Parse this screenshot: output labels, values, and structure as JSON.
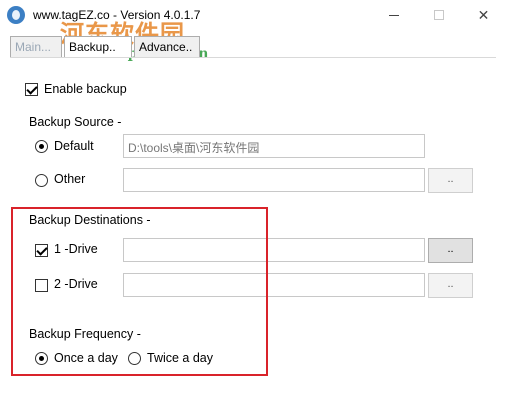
{
  "window": {
    "title": "www.tagEZ.co - Version 4.0.1.7",
    "controls": {
      "minimize": "minimize",
      "maximize": "maximize",
      "close": "✕"
    }
  },
  "watermark": {
    "text": "河东软件园",
    "url": "www.pc0359.cn"
  },
  "tabs": [
    {
      "label": "Main..."
    },
    {
      "label": "Backup.."
    },
    {
      "label": "Advance.."
    }
  ],
  "enable_backup": {
    "label": "Enable backup",
    "checked": true
  },
  "backup_source": {
    "title": "Backup Source -",
    "default_label": "Default",
    "default_path": "D:\\tools\\桌面\\河东软件园",
    "other_label": "Other",
    "other_value": "",
    "browse_label": ".."
  },
  "backup_destinations": {
    "title": "Backup Destinations -",
    "drive1_label": "1 -Drive",
    "drive1_checked": true,
    "drive1_value": "",
    "drive2_label": "2 -Drive",
    "drive2_checked": false,
    "drive2_value": "",
    "browse_label": ".."
  },
  "backup_frequency": {
    "title": "Backup Frequency -",
    "option1": "Once a day",
    "option2": "Twice a day",
    "selected": "Once a day"
  },
  "colors": {
    "highlight": "#d9232a",
    "watermark_text": "#e6862a",
    "watermark_url": "#2a9a3a"
  }
}
